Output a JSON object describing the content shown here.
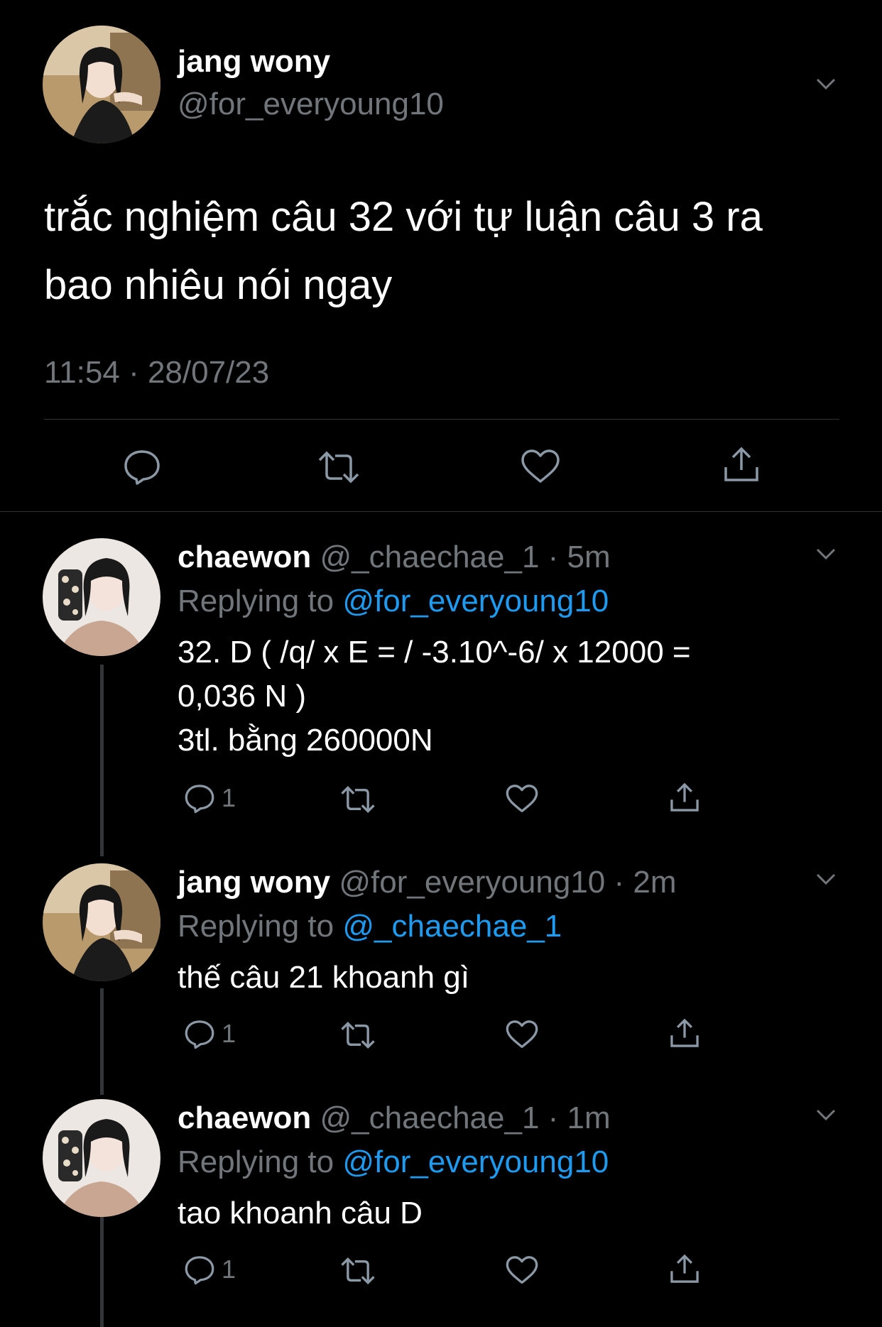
{
  "main_tweet": {
    "author_name": "jang wony",
    "author_handle": "@for_everyoung10",
    "avatar_icon": "avatar-photo-jang-wony",
    "text": "trắc nghiệm câu 32 với tự luận câu 3 ra bao nhiêu nói ngay",
    "timestamp": "11:54 · 28/07/23",
    "actions": [
      "reply-icon",
      "retweet-icon",
      "like-icon",
      "share-icon"
    ]
  },
  "replies": [
    {
      "author_name": "chaewon",
      "meta": "@_chaechae_1 · 5m",
      "replying_label": "Replying to",
      "replying_to": "@for_everyoung10",
      "text_lines": [
        "32. D ( /q/ x E = / -3.10^-6/ x 12000 =",
        "0,036 N )",
        "3tl. bằng 260000N"
      ],
      "reply_count": "1",
      "avatar_icon": "avatar-photo-chaewon"
    },
    {
      "author_name": "jang wony",
      "meta": "@for_everyoung10 · 2m",
      "replying_label": "Replying to",
      "replying_to": "@_chaechae_1",
      "text_lines": [
        "thế câu 21 khoanh gì"
      ],
      "reply_count": "1",
      "avatar_icon": "avatar-photo-jang-wony"
    },
    {
      "author_name": "chaewon",
      "meta": "@_chaechae_1 · 1m",
      "replying_label": "Replying to",
      "replying_to": "@for_everyoung10",
      "text_lines": [
        "tao khoanh câu D"
      ],
      "reply_count": "1",
      "avatar_icon": "avatar-photo-chaewon"
    }
  ],
  "colors": {
    "background": "#000000",
    "primary_text": "#ffffff",
    "secondary_text": "#71767b",
    "link": "#1d9bf0",
    "divider": "#2f3336"
  }
}
